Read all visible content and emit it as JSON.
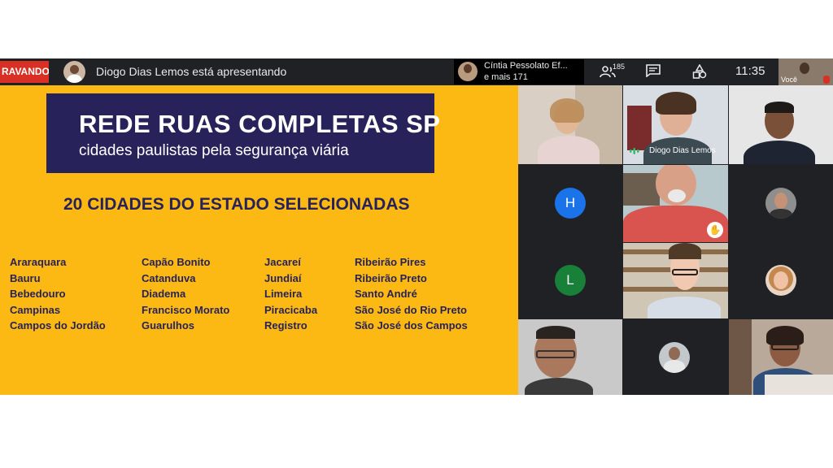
{
  "meeting_bar": {
    "recording_label": "RAVANDO",
    "presenting_text": "Diogo Dias Lemos está apresentando",
    "raised_hand_name": "Cíntia Pessolato Ef...",
    "raised_hand_more": "e mais 171",
    "participant_count": "185",
    "clock": "11:35",
    "self_label": "Você"
  },
  "slide": {
    "title": "REDE RUAS COMPLETAS SP",
    "subtitle": "cidades paulistas pela segurança viária",
    "heading": "20 CIDADES DO ESTADO SELECIONADAS",
    "columns": [
      [
        "Araraquara",
        "Bauru",
        "Bebedouro",
        "Campinas",
        "Campos do Jordão"
      ],
      [
        "Capão Bonito",
        "Catanduva",
        "Diadema",
        "Francisco Morato",
        "Guarulhos"
      ],
      [
        "Jacareí",
        "Jundiaí",
        "Limeira",
        "Piracicaba",
        "Registro"
      ],
      [
        "Ribeirão Pires",
        "Ribeirão Preto",
        "Santo André",
        "São José do Rio Preto",
        "São José dos Campos"
      ]
    ]
  },
  "participants": {
    "speaker_name": "Diogo Dias Lemos",
    "avatar_h": "H",
    "avatar_l": "L"
  },
  "colors": {
    "slide_bg": "#fdb913",
    "banner_bg": "#27235a",
    "record_red": "#d93025",
    "meet_dark": "#202124",
    "avatar_blue": "#1a73e8",
    "avatar_green": "#188038"
  },
  "icons": [
    "people-icon",
    "chat-icon",
    "activities-icon",
    "mic-off-icon",
    "raised-hand-icon",
    "speaking-icon"
  ]
}
